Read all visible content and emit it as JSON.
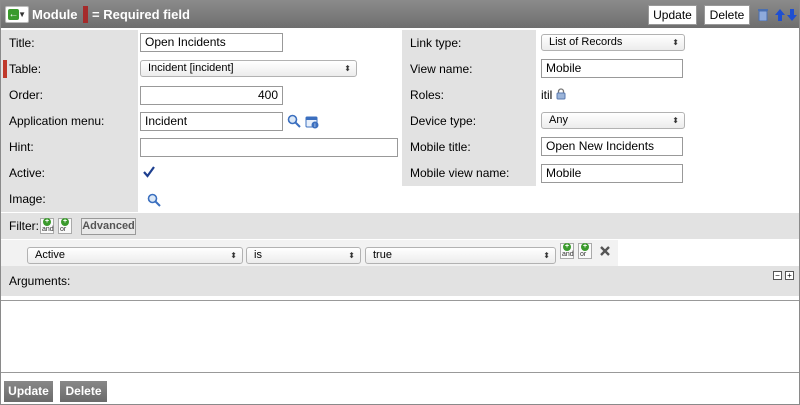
{
  "header": {
    "title": "Module",
    "required_legend": "= Required field",
    "update_label": "Update",
    "delete_label": "Delete"
  },
  "left": {
    "title_label": "Title:",
    "title_value": "Open Incidents",
    "table_label": "Table:",
    "table_value": "Incident [incident]",
    "order_label": "Order:",
    "order_value": "400",
    "appmenu_label": "Application menu:",
    "appmenu_value": "Incident",
    "hint_label": "Hint:",
    "hint_value": "",
    "active_label": "Active:",
    "image_label": "Image:"
  },
  "right": {
    "linktype_label": "Link type:",
    "linktype_value": "List of Records",
    "viewname_label": "View name:",
    "viewname_value": "Mobile",
    "roles_label": "Roles:",
    "roles_value": "itil",
    "devicetype_label": "Device type:",
    "devicetype_value": "Any",
    "mobiletitle_label": "Mobile title:",
    "mobiletitle_value": "Open New Incidents",
    "mobileview_label": "Mobile view name:",
    "mobileview_value": "Mobile"
  },
  "filter": {
    "label": "Filter:",
    "and_text": "and",
    "or_text": "or",
    "advanced_label": "Advanced",
    "condition": {
      "field": "Active",
      "operator": "is",
      "value": "true"
    }
  },
  "arguments": {
    "label": "Arguments:",
    "value": ""
  },
  "footer": {
    "update_label": "Update",
    "delete_label": "Delete"
  }
}
